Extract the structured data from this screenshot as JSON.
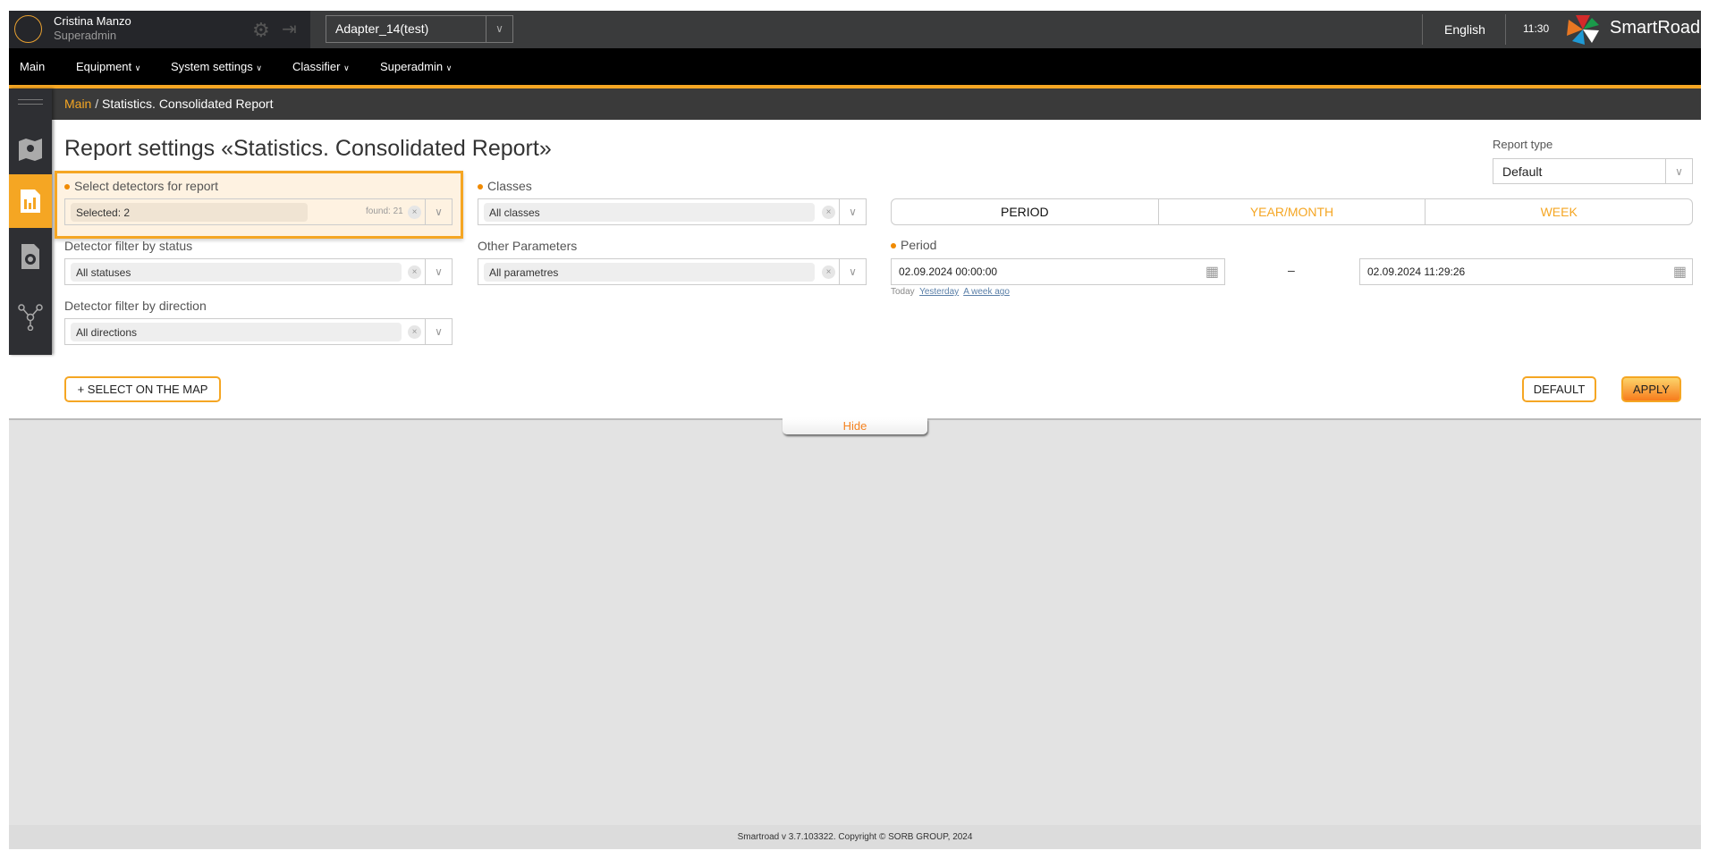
{
  "header": {
    "user_name": "Cristina Manzo",
    "user_role": "Superadmin",
    "adapter": "Adapter_14(test)",
    "language": "English",
    "time": "11:30",
    "brand": "SmartRoad"
  },
  "nav": [
    {
      "label": "Main"
    },
    {
      "label": "Equipment"
    },
    {
      "label": "System settings"
    },
    {
      "label": "Classifier"
    },
    {
      "label": "Superadmin"
    }
  ],
  "breadcrumb": {
    "home": "Main",
    "separator": "/",
    "current": "Statistics. Consolidated Report"
  },
  "sidebar": {
    "items": [
      {
        "icon": "map-icon"
      },
      {
        "icon": "report-icon",
        "active": true
      },
      {
        "icon": "camera-icon"
      },
      {
        "icon": "network-icon"
      }
    ]
  },
  "page": {
    "title": "Report settings «Statistics. Consolidated Report»"
  },
  "filters": {
    "detectors": {
      "label": "Select detectors for report",
      "value": "Selected: 2",
      "found": "found: 21"
    },
    "status": {
      "label": "Detector filter by status",
      "value": "All statuses"
    },
    "direction": {
      "label": "Detector filter by direction",
      "value": "All directions"
    },
    "classes": {
      "label": "Classes",
      "value": "All classes"
    },
    "other": {
      "label": "Other Parameters",
      "value": "All parametres"
    }
  },
  "report_type": {
    "label": "Report type",
    "value": "Default"
  },
  "tabs": [
    {
      "label": "PERIOD",
      "active": true
    },
    {
      "label": "YEAR/MONTH"
    },
    {
      "label": "WEEK"
    }
  ],
  "period": {
    "label": "Period",
    "from": "02.09.2024 00:00:00",
    "dash": "–",
    "to": "02.09.2024 11:29:26",
    "quick": [
      "Today",
      "Yesterday",
      "A week ago"
    ]
  },
  "buttons": {
    "select_map": "+ SELECT ON THE MAP",
    "default": "DEFAULT",
    "apply": "APPLY",
    "hide": "Hide"
  },
  "footer": "Smartroad v 3.7.103322. Copyright © SORB GROUP, 2024",
  "colors": {
    "accent": "#f5a623",
    "dark": "#3a3b3c"
  }
}
